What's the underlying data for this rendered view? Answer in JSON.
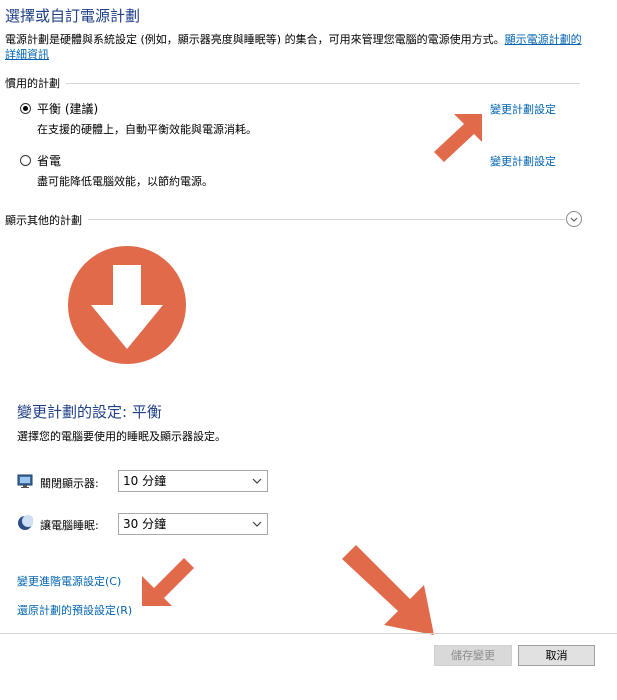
{
  "page": {
    "title": "選擇或自訂電源計劃",
    "description": "電源計劃是硬體與系統設定 (例如，顯示器亮度與睡眠等) 的集合，可用來管理您電腦的電源使用方式。",
    "description_link": "顯示電源計劃的詳細資訊"
  },
  "plans_section": {
    "label": "慣用的計劃",
    "plans": [
      {
        "name": "平衡 (建議)",
        "description": "在支援的硬體上，自動平衡效能與電源消耗。",
        "change_link": "變更計劃設定",
        "selected": true
      },
      {
        "name": "省電",
        "description": "盡可能降低電腦效能，以節約電源。",
        "change_link": "變更計劃設定",
        "selected": false
      }
    ]
  },
  "more_plans": {
    "label": "顯示其他的計劃"
  },
  "plan_settings": {
    "title": "變更計劃的設定: 平衡",
    "subtitle": "選擇您的電腦要使用的睡眠及顯示器設定。",
    "display_off": {
      "label": "關閉顯示器:",
      "value": "10 分鐘"
    },
    "sleep": {
      "label": "讓電腦睡眠:",
      "value": "30 分鐘"
    },
    "advanced_link": "變更進階電源設定(C)",
    "restore_link": "還原計劃的預設設定(R)"
  },
  "footer": {
    "save_label": "儲存變更",
    "cancel_label": "取消"
  },
  "colors": {
    "title": "#1f3f87",
    "link": "#0063b1",
    "annotation_arrow": "#e06a4a"
  }
}
